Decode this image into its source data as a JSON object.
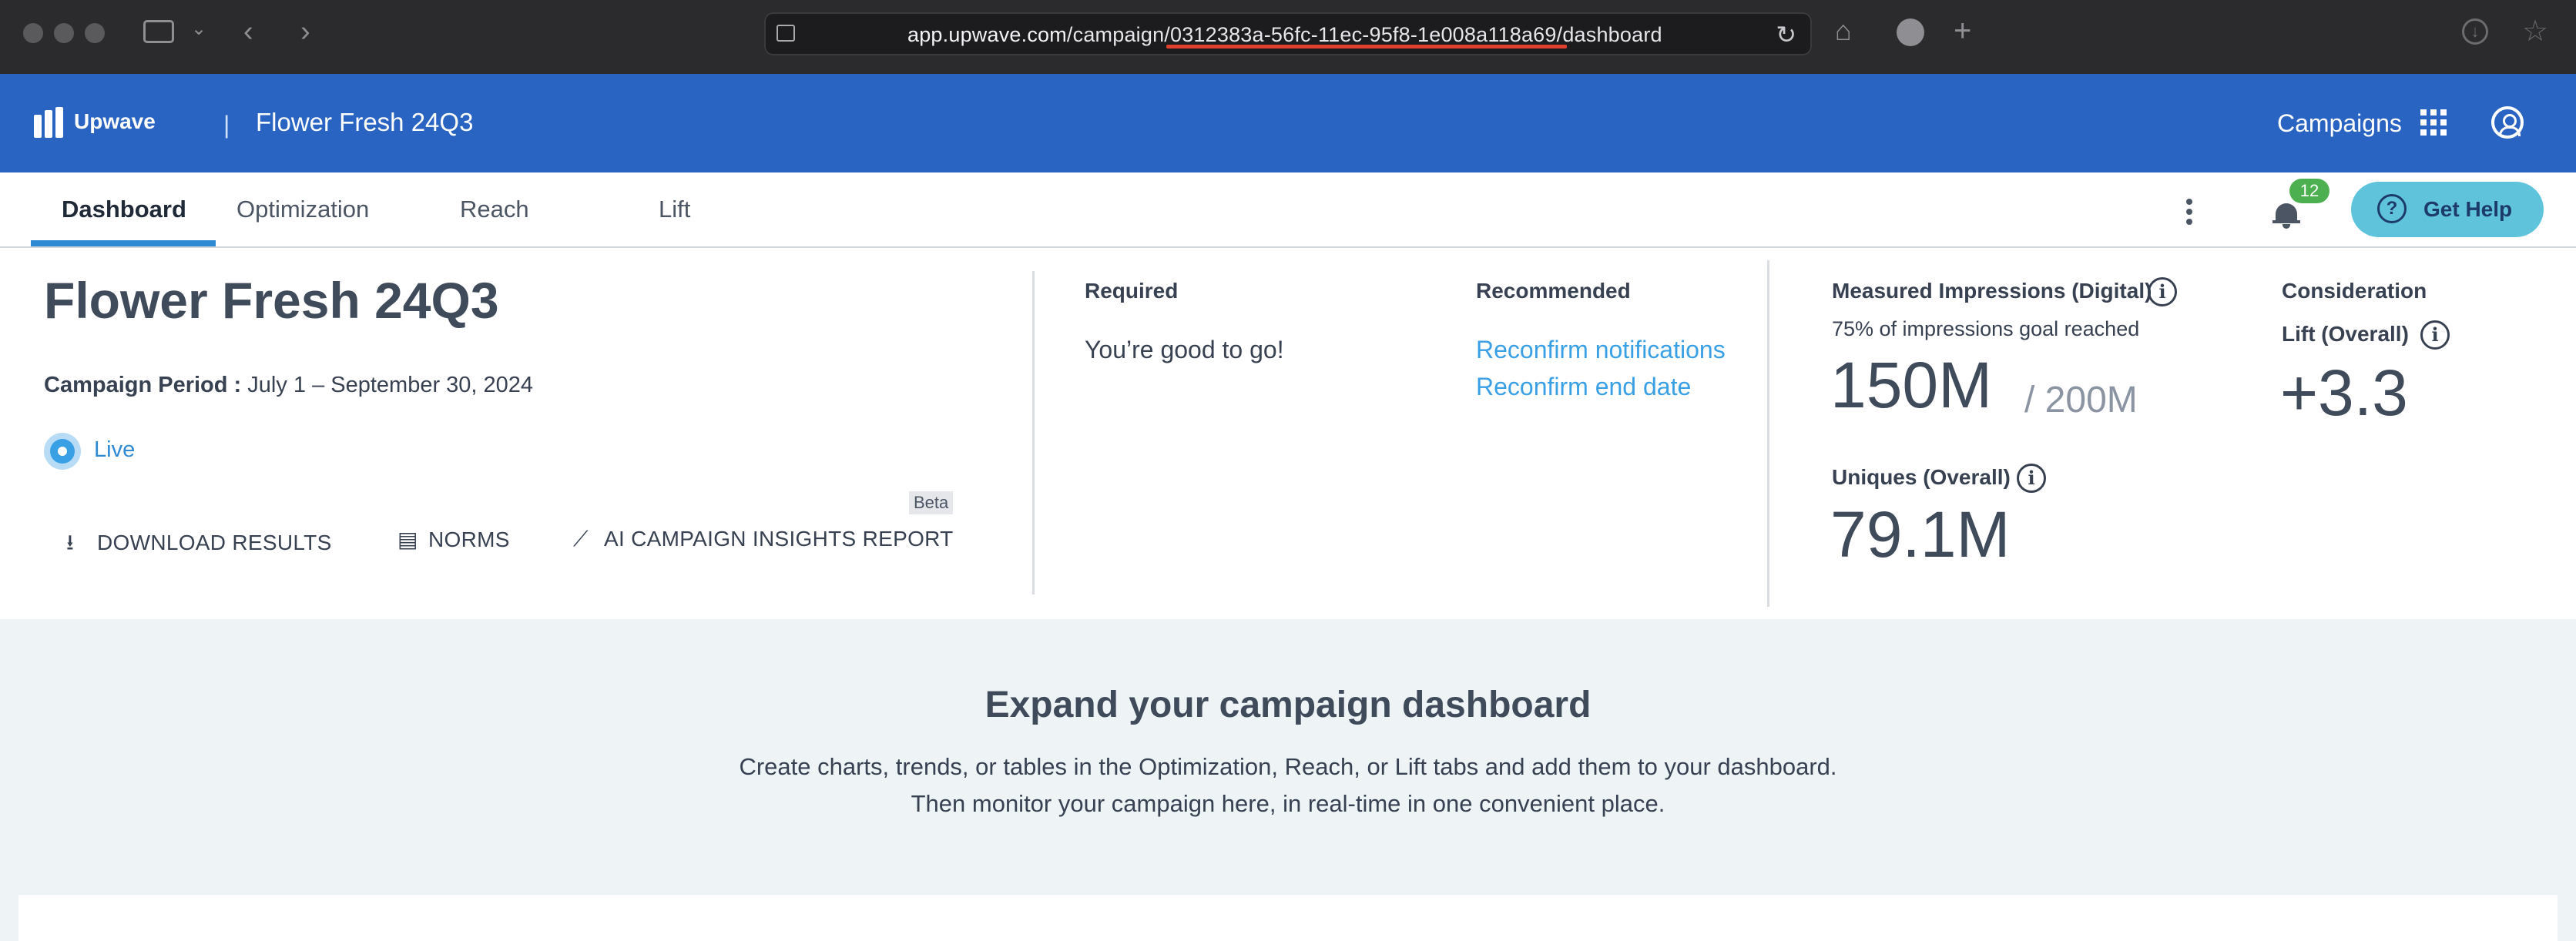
{
  "browser": {
    "url_host": "app.upwave.com",
    "url_path_prefix": "/campaign/",
    "url_campaign_id": "0312383a-56fc-11ec-95f8-1e008a118a69",
    "url_path_suffix": "/dashboard"
  },
  "header": {
    "logo_text": "Upwave",
    "separator": "|",
    "title": "Flower Fresh 24Q3",
    "campaigns_label": "Campaigns"
  },
  "tabs": [
    {
      "label": "Dashboard"
    },
    {
      "label": "Optimization"
    },
    {
      "label": "Reach"
    },
    {
      "label": "Lift"
    }
  ],
  "notifications": {
    "count": "12"
  },
  "help": {
    "label": "Get Help"
  },
  "summary": {
    "title": "Flower Fresh 24Q3",
    "period_label": "Campaign Period :",
    "period_value": "July 1 – September 30, 2024",
    "status": "Live",
    "actions": {
      "download": "DOWNLOAD RESULTS",
      "norms": "NORMS",
      "insights": "AI CAMPAIGN INSIGHTS REPORT",
      "beta": "Beta"
    },
    "required_head": "Required",
    "required_text": "You’re good to go!",
    "recommended_head": "Recommended",
    "recommended_links": [
      "Reconfirm notifications",
      "Reconfirm end date"
    ]
  },
  "metrics": {
    "impressions_head": "Measured Impressions (Digital)",
    "impressions_sub": "75% of impressions goal reached",
    "impressions_value": "150M",
    "impressions_goal": "/ 200M",
    "uniques_head": "Uniques (Overall)",
    "uniques_value": "79.1M",
    "consideration_head": "Consideration",
    "lift_head": "Lift (Overall)",
    "lift_value": "+3.3"
  },
  "expand": {
    "title": "Expand your campaign dashboard",
    "line1": "Create charts, trends, or tables in the Optimization, Reach, or Lift tabs and add them to your dashboard.",
    "line2": "Then monitor your campaign here, in real-time in one convenient place."
  }
}
